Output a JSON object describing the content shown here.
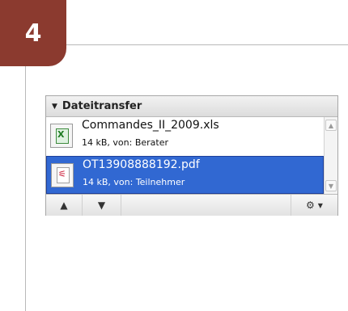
{
  "step": {
    "number": "4"
  },
  "panel": {
    "title": "Dateitransfer",
    "files": [
      {
        "name": "Commandes_II_2009.xls",
        "meta": "14 kB, von: Berater",
        "type": "xls-icon",
        "selected": false
      },
      {
        "name": "OT13908888192.pdf",
        "meta": "14 kB, von: Teilnehmer",
        "type": "pdf-icon",
        "selected": true
      }
    ]
  },
  "toolbar": {
    "move_up": "up-arrow-icon",
    "move_down": "down-arrow-icon",
    "options": "gear-icon"
  },
  "colors": {
    "badge": "#8b3a2f",
    "selection": "#3168d2"
  }
}
